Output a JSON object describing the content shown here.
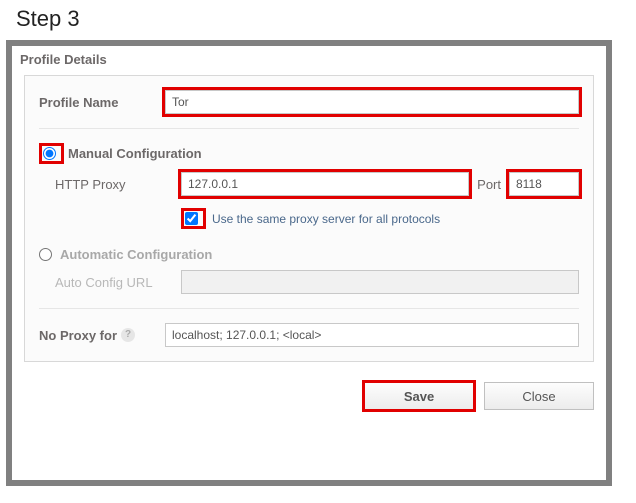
{
  "step": "Step 3",
  "panel": {
    "title": "Profile Details",
    "profileNameLabel": "Profile Name",
    "profileNameValue": "Tor"
  },
  "manual": {
    "title": "Manual Configuration",
    "selected": true,
    "httpProxyLabel": "HTTP Proxy",
    "httpProxyValue": "127.0.0.1",
    "portLabel": "Port",
    "portValue": "8118",
    "sameProxyChecked": true,
    "sameProxyLabel": "Use the same proxy server for all protocols"
  },
  "auto": {
    "title": "Automatic Configuration",
    "selected": false,
    "autoUrlLabel": "Auto Config URL",
    "autoUrlValue": ""
  },
  "noProxy": {
    "label": "No Proxy for",
    "value": "localhost; 127.0.0.1; <local>"
  },
  "buttons": {
    "save": "Save",
    "close": "Close"
  }
}
